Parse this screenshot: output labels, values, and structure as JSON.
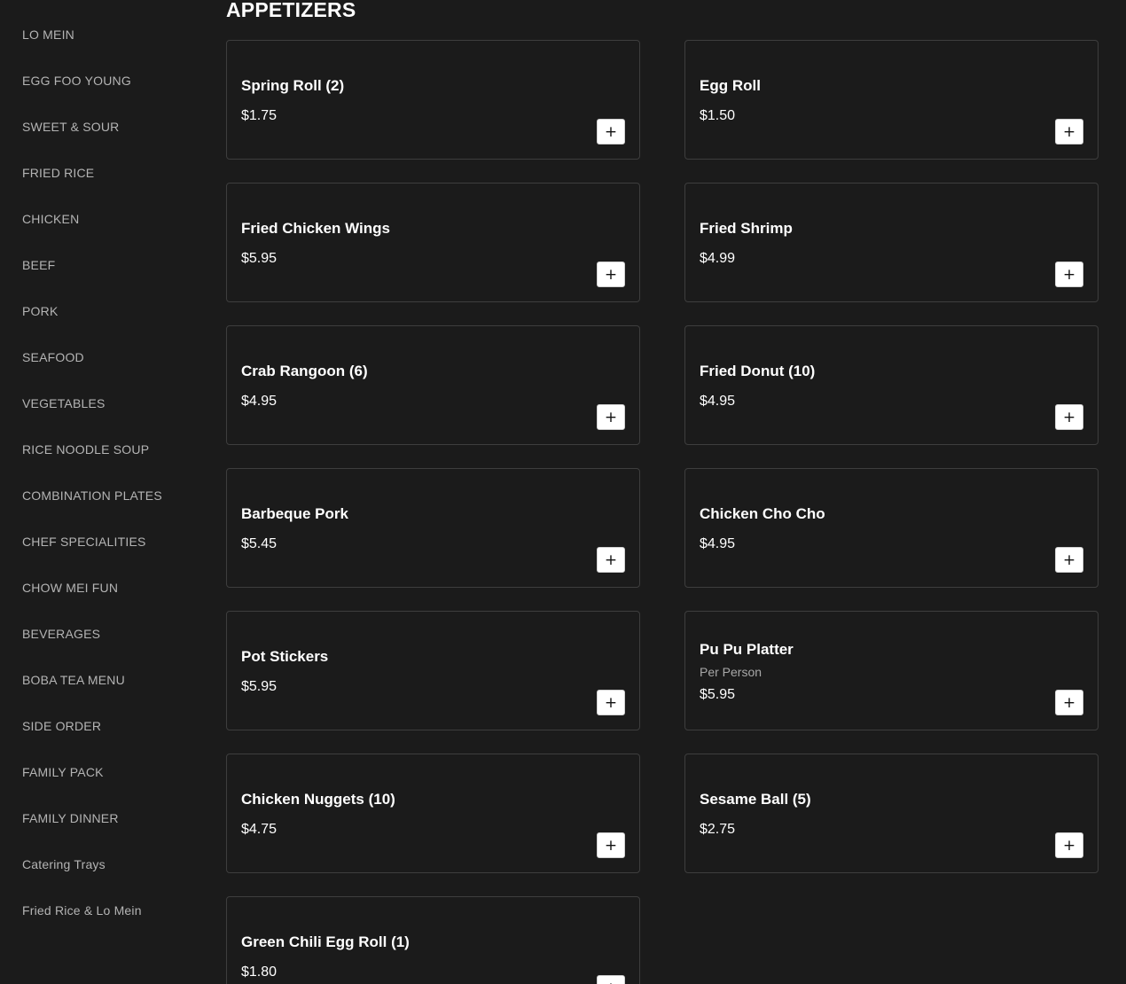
{
  "sidebar": {
    "items": [
      {
        "label": "LO MEIN"
      },
      {
        "label": "EGG FOO YOUNG"
      },
      {
        "label": "SWEET & SOUR"
      },
      {
        "label": "FRIED RICE"
      },
      {
        "label": "CHICKEN"
      },
      {
        "label": "BEEF"
      },
      {
        "label": "PORK"
      },
      {
        "label": "SEAFOOD"
      },
      {
        "label": "VEGETABLES"
      },
      {
        "label": "RICE NOODLE SOUP"
      },
      {
        "label": "COMBINATION PLATES"
      },
      {
        "label": "CHEF SPECIALITIES"
      },
      {
        "label": "CHOW MEI FUN"
      },
      {
        "label": "BEVERAGES"
      },
      {
        "label": "BOBA TEA MENU"
      },
      {
        "label": "SIDE ORDER"
      },
      {
        "label": "FAMILY PACK"
      },
      {
        "label": "FAMILY DINNER"
      },
      {
        "label": "Catering Trays"
      },
      {
        "label": "Fried Rice & Lo Mein"
      }
    ]
  },
  "section": {
    "title": "APPETIZERS"
  },
  "menu_items": [
    {
      "name": "Spring Roll (2)",
      "price": "$1.75"
    },
    {
      "name": "Egg Roll",
      "price": "$1.50"
    },
    {
      "name": "Fried Chicken Wings",
      "price": "$5.95"
    },
    {
      "name": "Fried Shrimp",
      "price": "$4.99"
    },
    {
      "name": "Crab Rangoon (6)",
      "price": "$4.95"
    },
    {
      "name": "Fried Donut (10)",
      "price": "$4.95"
    },
    {
      "name": "Barbeque Pork",
      "price": "$5.45"
    },
    {
      "name": "Chicken Cho Cho",
      "price": "$4.95"
    },
    {
      "name": "Pot Stickers",
      "price": "$5.95"
    },
    {
      "name": "Pu Pu Platter",
      "description": "Per Person",
      "price": "$5.95"
    },
    {
      "name": "Chicken Nuggets (10)",
      "price": "$4.75"
    },
    {
      "name": "Sesame Ball (5)",
      "price": "$2.75"
    },
    {
      "name": "Green Chili Egg Roll (1)",
      "price": "$1.80"
    }
  ],
  "add_button": {
    "symbol": "+",
    "icon": "plus-icon"
  },
  "colors": {
    "background": "#1b1b1b",
    "card_border": "#3e3e3e",
    "text_primary": "#ffffff",
    "text_nav": "#b4b4b4",
    "button_bg": "#ffffff"
  }
}
